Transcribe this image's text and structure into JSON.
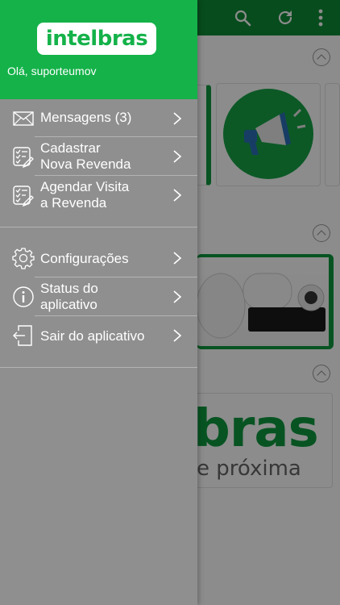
{
  "drawer": {
    "logo_text": "intelbras",
    "greeting": "Olá, suporteumov",
    "items": [
      {
        "label": "Mensagens (3)",
        "icon": "envelope-icon"
      },
      {
        "label": "Cadastrar\nNova Revenda",
        "icon": "checklist-edit-icon"
      },
      {
        "label": "Agendar Visita\na Revenda",
        "icon": "checklist-edit-icon"
      },
      {
        "label": "Configurações",
        "icon": "gear-icon"
      },
      {
        "label": "Status do\naplicativo",
        "icon": "info-icon"
      },
      {
        "label": "Sair do aplicativo",
        "icon": "exit-door-icon"
      }
    ]
  },
  "background": {
    "toolbar_icons": [
      "search-icon",
      "refresh-icon",
      "more-vertical-icon"
    ],
    "logo_fragment": "bras",
    "tagline_fragment": "e próxima"
  },
  "colors": {
    "header_green": "#14b249",
    "topbar_green": "#0d8a35",
    "drawer_gray": "#8f8f8f"
  }
}
